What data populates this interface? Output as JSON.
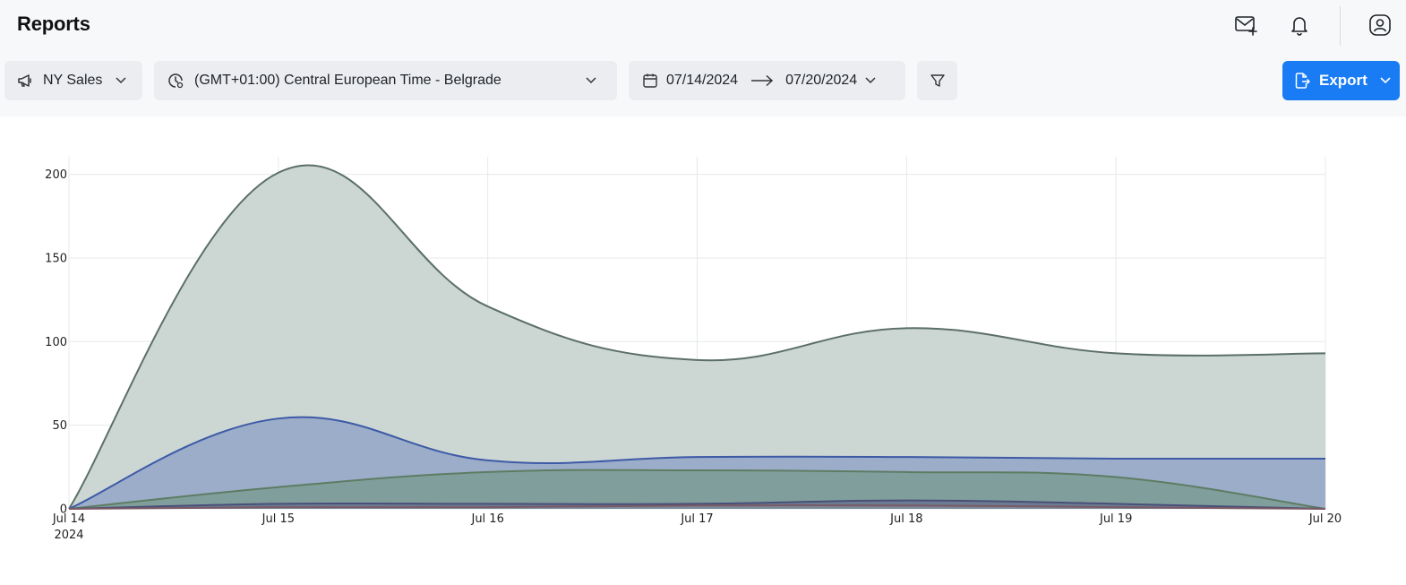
{
  "header": {
    "title": "Reports",
    "icons": [
      "mail-plus-icon",
      "bell-icon",
      "user-circle-icon"
    ]
  },
  "filters": {
    "campaign": {
      "icon": "megaphone-icon",
      "label": "NY Sales"
    },
    "timezone": {
      "icon": "clock-icon",
      "label": "(GMT+01:00) Central European Time - Belgrade"
    },
    "date_range": {
      "icon": "calendar-icon",
      "start": "07/14/2024",
      "end": "07/20/2024"
    },
    "filter_icon": "funnel-icon",
    "export": {
      "icon": "file-export-icon",
      "label": "Export"
    }
  },
  "colors": {
    "accent": "#1a7cf5",
    "series": [
      "#5b6f67",
      "#3e5aa6",
      "#5e7c63",
      "#4a4f78",
      "#7a5a66"
    ]
  },
  "chart_data": {
    "type": "area",
    "x": [
      "2024-07-14",
      "2024-07-15",
      "2024-07-16",
      "2024-07-17",
      "2024-07-18",
      "2024-07-19",
      "2024-07-20"
    ],
    "x_tick_labels": [
      "Jul 14",
      "Jul 15",
      "Jul 16",
      "Jul 17",
      "Jul 18",
      "Jul 19",
      "Jul 20"
    ],
    "x_first_sublabel": "2024",
    "y_ticks": [
      "0",
      "50",
      "100",
      "150",
      "200"
    ],
    "ylim": [
      0,
      210
    ],
    "grid": true,
    "series": [
      {
        "values": [
          0,
          201,
          121,
          89,
          108,
          93,
          93
        ],
        "color": "#5b6f67",
        "fill": "#ccd7d4"
      },
      {
        "values": [
          0,
          54,
          29,
          31,
          31,
          30,
          30
        ],
        "color": "#3e5aa6",
        "fill": "#9badc9"
      },
      {
        "values": [
          0,
          13,
          22,
          23,
          22,
          19,
          0
        ],
        "color": "#5e7c63",
        "fill": "#809f9c"
      },
      {
        "values": [
          0,
          3,
          3,
          3,
          5,
          3,
          0
        ],
        "color": "#4a4f78",
        "fill": "#6b7c92"
      },
      {
        "values": [
          0,
          1,
          1,
          2,
          2,
          1,
          0
        ],
        "color": "#7a5a66",
        "fill": "#7a8898"
      }
    ]
  }
}
